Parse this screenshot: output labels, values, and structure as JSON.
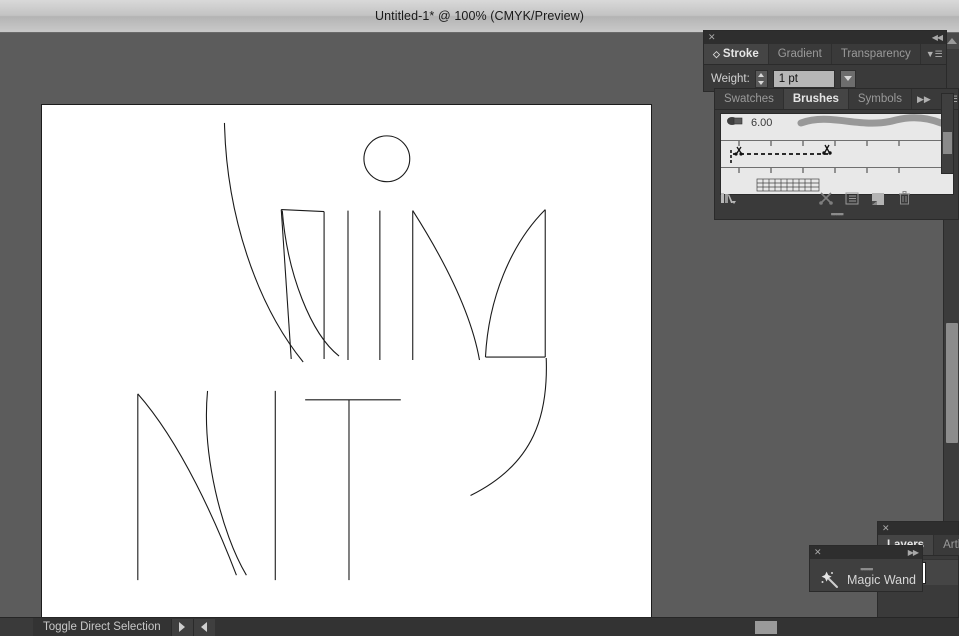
{
  "window": {
    "title": "Untitled-1* @ 100% (CMYK/Preview)",
    "zoom": "100%",
    "color_mode": "CMYK",
    "view_mode": "Preview",
    "document_name": "Untitled-1*"
  },
  "stroke_panel": {
    "close_icon": "close-icon",
    "collapse_icon": "collapse-to-icons",
    "menu_icon": "panel-menu-icon",
    "tabs": [
      {
        "label": "Stroke",
        "active": true
      },
      {
        "label": "Gradient",
        "active": false
      },
      {
        "label": "Transparency",
        "active": false
      }
    ],
    "weight_label": "Weight:",
    "weight_value": "1 pt",
    "stepper_icon": "stepper-arrows-icon",
    "dropdown_icon": "chevron-down-icon"
  },
  "brushes_panel": {
    "tabs": [
      {
        "label": "Swatches",
        "active": false
      },
      {
        "label": "Brushes",
        "active": true
      },
      {
        "label": "Symbols",
        "active": false
      }
    ],
    "expand_icon": "expand-arrows-icon",
    "menu_icon": "panel-menu-icon",
    "brushes": [
      {
        "name": "calligraphic-brush",
        "label": "6.00",
        "preview": "tapered-stroke"
      },
      {
        "name": "pattern-brush-dashes",
        "label": "",
        "preview": "dashed-scissors"
      },
      {
        "name": "pattern-brush-grid",
        "label": "",
        "preview": "grid-swatch"
      }
    ],
    "footer_icons": [
      "brush-libraries-menu-icon",
      "remove-brush-stroke-icon",
      "brush-options-icon",
      "new-brush-icon",
      "delete-brush-icon"
    ],
    "scrollbar": "vertical-scrollbar"
  },
  "layers_panel": {
    "close_icon": "close-icon",
    "tabs": [
      {
        "label": "Layers",
        "active": true
      },
      {
        "label": "Artbo",
        "active": false
      }
    ],
    "row": {
      "disclosure_icon": "disclosure-triangle-icon",
      "color_swatch": "#2e7ed8",
      "thumbnail": "layer-thumbnail"
    }
  },
  "magic_wand_panel": {
    "close_icon": "close-icon",
    "expand_icon": "expand-arrows-icon",
    "grip_icon": "drag-grip-icon",
    "icon": "magic-wand-icon",
    "label": "Magic Wand"
  },
  "status_bar": {
    "text": "Toggle Direct Selection",
    "next_icon": "arrow-right-icon",
    "prev_icon": "arrow-left-icon"
  },
  "scrollbars": {
    "vertical_up_icon": "arrow-up-icon",
    "vertical_down_icon": "arrow-down-icon"
  },
  "artwork": {
    "description": "Thin black vector line-art letterforms on white artboard",
    "stroke_color": "#1a1a1a",
    "background": "#ffffff"
  }
}
